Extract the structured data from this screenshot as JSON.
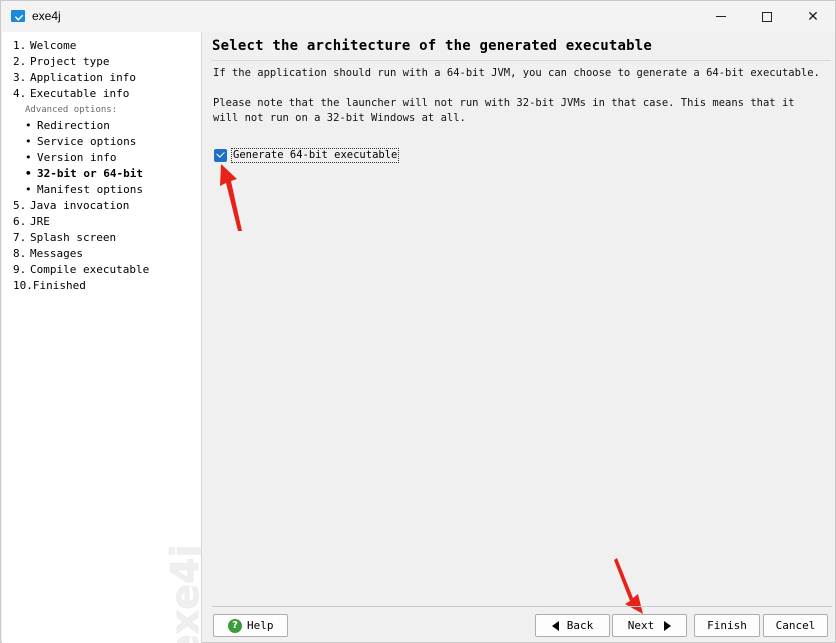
{
  "window": {
    "title": "exe4j",
    "icon": "exe4j-app-icon",
    "minimize_icon": "minimize-icon",
    "maximize_icon": "maximize-icon",
    "close_glyph": "✕"
  },
  "sidebar": {
    "items": [
      {
        "num": "1.",
        "label": "Welcome"
      },
      {
        "num": "2.",
        "label": "Project type"
      },
      {
        "num": "3.",
        "label": "Application info"
      },
      {
        "num": "4.",
        "label": "Executable info"
      }
    ],
    "advanced_caption": "Advanced options:",
    "sub_items": [
      {
        "bullet": "•",
        "label": "Redirection"
      },
      {
        "bullet": "•",
        "label": "Service options"
      },
      {
        "bullet": "•",
        "label": "Version info"
      },
      {
        "bullet": "•",
        "label": "32-bit or 64-bit"
      },
      {
        "bullet": "•",
        "label": "Manifest options"
      }
    ],
    "items_after": [
      {
        "num": "5.",
        "label": "Java invocation"
      },
      {
        "num": "6.",
        "label": "JRE"
      },
      {
        "num": "7.",
        "label": "Splash screen"
      },
      {
        "num": "8.",
        "label": "Messages"
      },
      {
        "num": "9.",
        "label": "Compile executable"
      },
      {
        "num": "10.",
        "label": "Finished"
      }
    ],
    "active_item": "32-bit or 64-bit",
    "watermark": "exe4j"
  },
  "main": {
    "heading": "Select the architecture of the generated executable",
    "para1": "If the application should run with a 64-bit JVM, you can choose to generate a 64-bit executable.",
    "para2": "Please note that the launcher will not run with 32-bit JVMs in that case. This means that it will not run on a 32-bit Windows at all.",
    "checkbox": {
      "label": "Generate 64-bit executable",
      "checked": true
    }
  },
  "buttons": {
    "help": "Help",
    "back": "Back",
    "next": "Next",
    "finish": "Finish",
    "cancel": "Cancel"
  },
  "colors": {
    "accent": "#1f6fc8",
    "annotation_arrow": "#e8221b",
    "help_icon": "#3a9c3a"
  }
}
